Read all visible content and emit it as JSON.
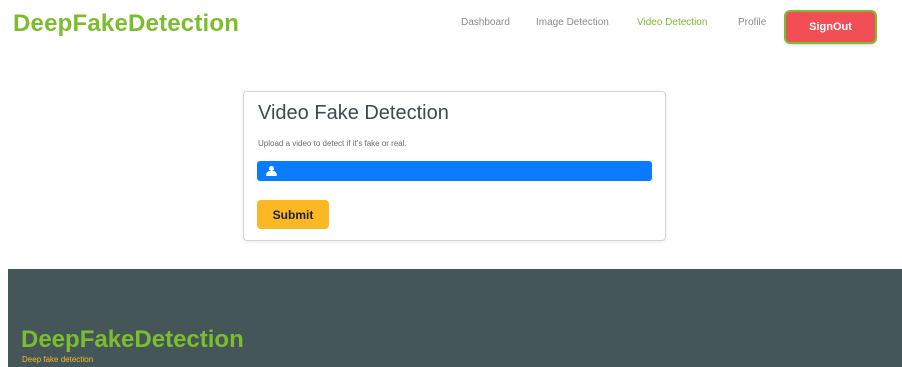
{
  "header": {
    "brand": "DeepFakeDetection",
    "nav": [
      {
        "label": "Dashboard",
        "active": false
      },
      {
        "label": "Image Detection",
        "active": false
      },
      {
        "label": "Video Detection",
        "active": true
      },
      {
        "label": "Profile",
        "active": false
      }
    ],
    "signout_label": "SignOut"
  },
  "card": {
    "title": "Video Fake Detection",
    "description": "Upload a video to detect if it's fake or real.",
    "file_input_icon": "user-icon",
    "submit_label": "Submit"
  },
  "footer": {
    "brand": "DeepFakeDetection",
    "tagline": "Deep fake detection"
  },
  "colors": {
    "brand_green": "#7cbd2e",
    "signout_red": "#f24e55",
    "file_bar_blue": "#0a7bff",
    "submit_yellow": "#fbb724",
    "footer_bg": "#455658"
  }
}
